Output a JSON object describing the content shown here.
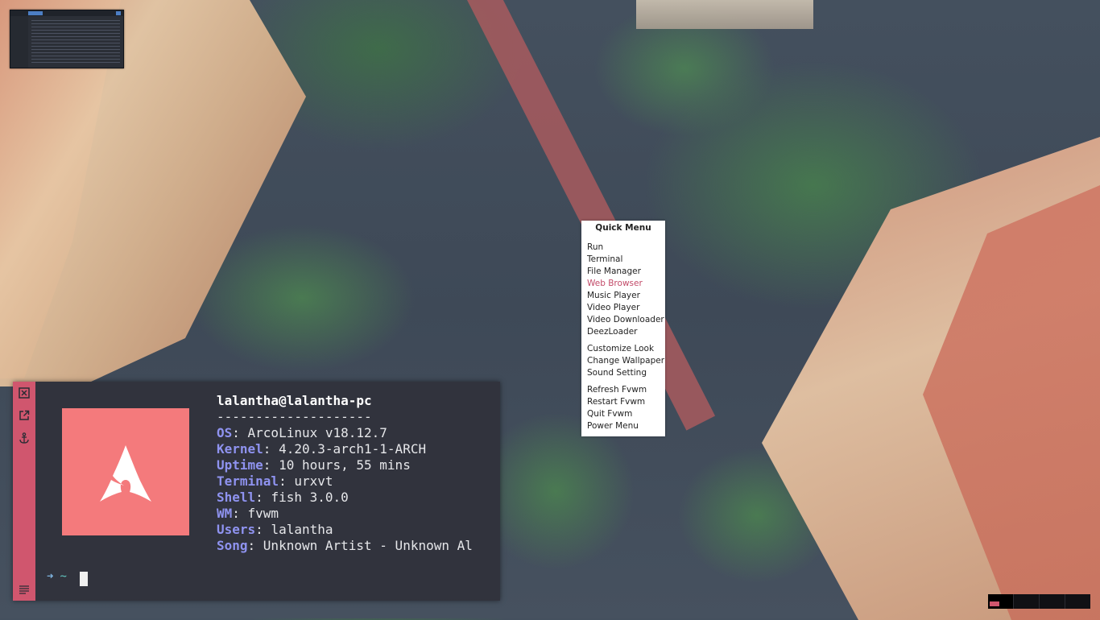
{
  "desktop": {
    "wallpaper": "aerial-city-street"
  },
  "mini_window": {
    "label": "file-manager-thumbnail"
  },
  "quick_menu": {
    "title": "Quick Menu",
    "items": [
      {
        "label": "Run"
      },
      {
        "label": "Terminal"
      },
      {
        "label": "File Manager"
      },
      {
        "label": "Web Browser",
        "highlighted": true
      },
      {
        "label": "Music Player"
      },
      {
        "label": "Video Player"
      },
      {
        "label": "Video Downloader"
      },
      {
        "label": "DeezLoader"
      },
      {
        "label": "Customize Look"
      },
      {
        "label": "Change Wallpaper"
      },
      {
        "label": "Sound Setting"
      },
      {
        "label": "Refresh Fvwm"
      },
      {
        "label": "Restart Fvwm"
      },
      {
        "label": "Quit Fvwm"
      },
      {
        "label": "Power Menu"
      }
    ],
    "highlight_color": "#c24a68"
  },
  "terminal": {
    "sidebar_icons": [
      "close-icon",
      "external-link-icon",
      "anchor-icon",
      "menu-lines-icon"
    ],
    "accent": "#d0566e",
    "logo_color": "#f47a7c",
    "userhost": "lalantha@lalantha-pc",
    "separator": "--------------------",
    "info": [
      {
        "key": "OS",
        "value": ": ArcoLinux v18.12.7"
      },
      {
        "key": "Kernel",
        "value": ": 4.20.3-arch1-1-ARCH"
      },
      {
        "key": "Uptime",
        "value": ": 10 hours, 55 mins"
      },
      {
        "key": "Terminal",
        "value": ": urxvt"
      },
      {
        "key": "Shell",
        "value": ": fish 3.0.0"
      },
      {
        "key": "WM",
        "value": ": fvwm"
      },
      {
        "key": "Users",
        "value": ": lalantha"
      },
      {
        "key": "Song",
        "value": ": Unknown Artist - Unknown Al"
      }
    ],
    "prompt_arrow": "➜",
    "prompt_dir": "~"
  },
  "pager": {
    "desks": 4,
    "active_desk": 1
  }
}
